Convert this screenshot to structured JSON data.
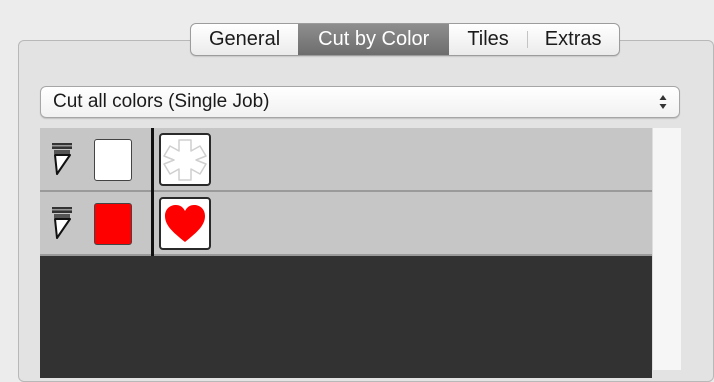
{
  "tabs": [
    {
      "label": "General",
      "selected": false
    },
    {
      "label": "Cut by Color",
      "selected": true
    },
    {
      "label": "Tiles",
      "selected": false
    },
    {
      "label": "Extras",
      "selected": false
    }
  ],
  "cut_mode": {
    "value": "Cut all colors (Single Job)",
    "icon": "updown-arrows-icon"
  },
  "color_rows": [
    {
      "tool_icon": "cutter-blade-icon",
      "color": "#ffffff",
      "shape_icon": "white-outline-shape-icon"
    },
    {
      "tool_icon": "cutter-blade-icon",
      "color": "#ff0000",
      "shape_icon": "red-heart-icon"
    }
  ]
}
